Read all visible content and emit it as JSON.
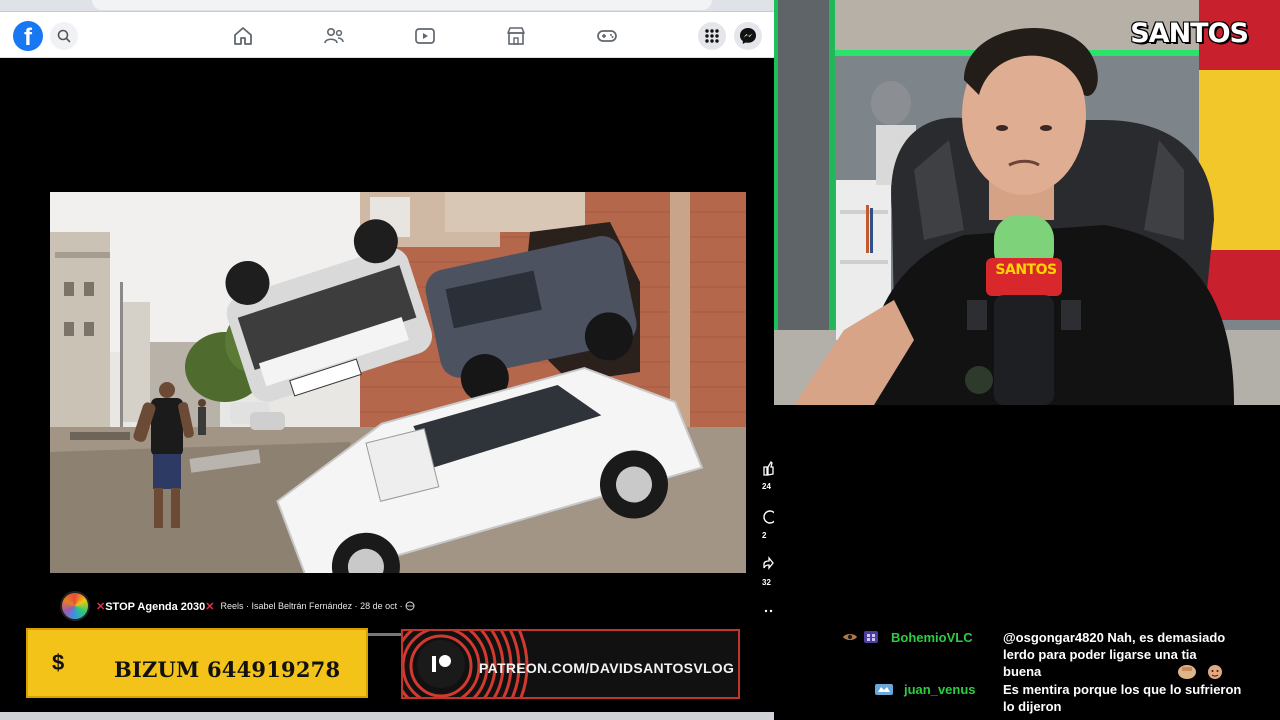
{
  "browser": {
    "url": "facebook.com/reel/...",
    "facebook": {
      "logo": "f",
      "nav": [
        "home-icon",
        "friends-icon",
        "video-icon",
        "marketplace-icon",
        "gaming-icon"
      ],
      "right": [
        "menu-grid-icon",
        "messenger-icon"
      ]
    },
    "post": {
      "group_prefix": "✕",
      "group_name": "STOP Agenda 2030",
      "group_suffix": "✕",
      "info": "Reels · Isabel Beltrán Fernández · 28 de oct · ",
      "side_counts": [
        "24",
        "2",
        "32"
      ],
      "side_icons": [
        "like-icon",
        "comment-icon",
        "share-icon",
        "more-icon"
      ]
    }
  },
  "overlays": {
    "bizum_symbol": "$",
    "bizum_text": "BIZUM 644919278",
    "patreon_text": "PATREON.COM/DAVIDSANTOSVLOG"
  },
  "webcam": {
    "logo": "SANTOS",
    "mic_label": "SANTOS"
  },
  "chat": {
    "messages": [
      {
        "user": "BohemioVLC",
        "user_color": "#2ecc40",
        "text": "@osgongar4820 Nah, es demasiado lerdo para poder ligarse una tia buena"
      },
      {
        "user": "juan_venus",
        "user_color": "#2ecc40",
        "text": "Es mentira porque los que lo sufrieron lo dijeron"
      }
    ]
  },
  "colors": {
    "facebook_blue": "#1877f2",
    "bizum_yellow": "#f4c31a",
    "patreon_red": "#c0362c",
    "chat_user_green": "#2ecc40"
  }
}
